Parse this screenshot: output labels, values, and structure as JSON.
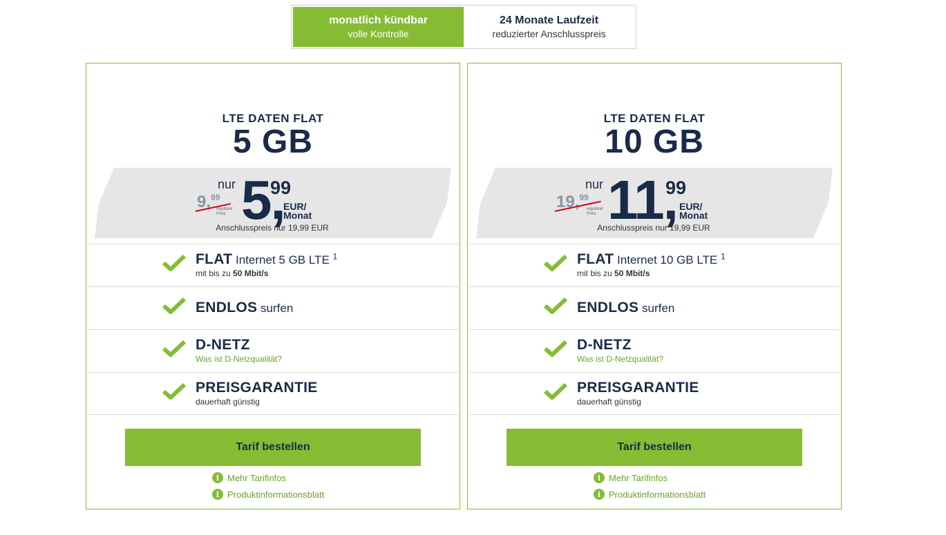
{
  "toggle": {
    "monthly": {
      "title": "monatlich kündbar",
      "subtitle": "volle Kontrolle"
    },
    "contract": {
      "title": "24 Monate Laufzeit",
      "subtitle": "reduzierter Anschlusspreis"
    }
  },
  "plans": [
    {
      "name": "LTE DATEN FLAT",
      "size": "5 GB",
      "old_price_main": "9,",
      "old_price_cents": "99",
      "regular_label": "regulärer Preis",
      "nur": "nur",
      "price_main": "5,",
      "price_cents": "99",
      "price_unit": "EUR/ Monat",
      "setup": "Anschlusspreis nur 19,99 EUR",
      "features": {
        "flat_bold": "FLAT",
        "flat_rest": "Internet 5 GB LTE",
        "flat_sup": "1",
        "flat_sub_pre": "mit bis zu",
        "flat_sub_bold": "50 Mbit/s",
        "endlos_bold": "ENDLOS",
        "endlos_rest": "surfen",
        "dnetz_bold": "D-NETZ",
        "dnetz_link": "Was ist D-Netzqualität?",
        "preis_bold": "PREISGARANTIE",
        "preis_sub": "dauerhaft günstig"
      },
      "order_label": "Tarif bestellen",
      "info_link": "Mehr Tarifinfos",
      "pib_link": "Produktinformationsblatt"
    },
    {
      "name": "LTE DATEN FLAT",
      "size": "10 GB",
      "old_price_main": "19,",
      "old_price_cents": "99",
      "regular_label": "regulärer Preis",
      "nur": "nur",
      "price_main": "11,",
      "price_cents": "99",
      "price_unit": "EUR/ Monat",
      "setup": "Anschlusspreis nur 19,99 EUR",
      "features": {
        "flat_bold": "FLAT",
        "flat_rest": "Internet 10 GB LTE",
        "flat_sup": "1",
        "flat_sub_pre": "mit bis zu",
        "flat_sub_bold": "50 Mbit/s",
        "endlos_bold": "ENDLOS",
        "endlos_rest": "surfen",
        "dnetz_bold": "D-NETZ",
        "dnetz_link": "Was ist D-Netzqualität?",
        "preis_bold": "PREISGARANTIE",
        "preis_sub": "dauerhaft günstig"
      },
      "order_label": "Tarif bestellen",
      "info_link": "Mehr Tarifinfos",
      "pib_link": "Produktinformationsblatt"
    }
  ],
  "colors": {
    "accent": "#86bc34",
    "text": "#1a2b49",
    "strike": "#d0021b",
    "band": "#e6e6e6"
  },
  "icons": {
    "check": "check-icon",
    "info": "info-icon"
  }
}
